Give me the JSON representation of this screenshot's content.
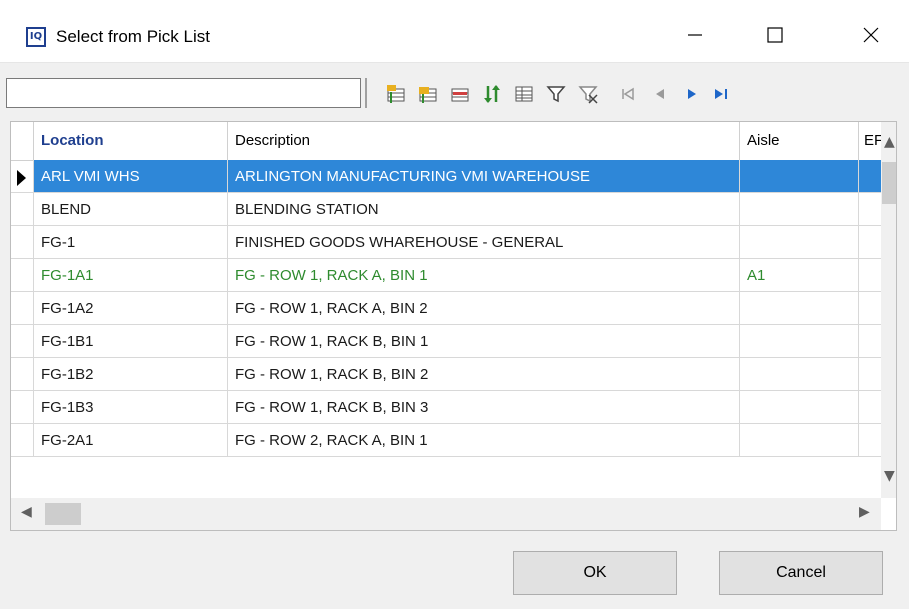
{
  "window": {
    "title": "Select from Pick List",
    "icon_text": "IQ"
  },
  "search": {
    "value": "",
    "placeholder": ""
  },
  "toolbar": {
    "icons": [
      "insert-before-icon",
      "insert-after-icon",
      "delete-record-icon",
      "sort-icon",
      "grid-layout-icon",
      "filter-icon",
      "clear-filter-icon",
      "first-record-icon",
      "prior-record-icon",
      "next-record-icon",
      "last-record-icon"
    ]
  },
  "grid": {
    "columns": [
      "Location",
      "Description",
      "Aisle",
      "EF"
    ],
    "rows": [
      {
        "location": "ARL VMI WHS",
        "description": "ARLINGTON MANUFACTURING VMI WAREHOUSE",
        "aisle": "",
        "ef": "",
        "state": "selected"
      },
      {
        "location": "BLEND",
        "description": "BLENDING STATION",
        "aisle": "",
        "ef": "",
        "state": "normal"
      },
      {
        "location": "FG-1",
        "description": "FINISHED GOODS WHAREHOUSE - GENERAL",
        "aisle": "",
        "ef": "",
        "state": "normal"
      },
      {
        "location": "FG-1A1",
        "description": "FG - ROW 1, RACK A, BIN 1",
        "aisle": "A1",
        "ef": "",
        "state": "green"
      },
      {
        "location": "FG-1A2",
        "description": "FG - ROW 1, RACK A, BIN 2",
        "aisle": "",
        "ef": "",
        "state": "normal"
      },
      {
        "location": "FG-1B1",
        "description": "FG - ROW 1, RACK B, BIN 1",
        "aisle": "",
        "ef": "",
        "state": "normal"
      },
      {
        "location": "FG-1B2",
        "description": "FG - ROW 1, RACK B, BIN 2",
        "aisle": "",
        "ef": "",
        "state": "normal"
      },
      {
        "location": "FG-1B3",
        "description": "FG - ROW 1, RACK B, BIN 3",
        "aisle": "",
        "ef": "",
        "state": "normal"
      },
      {
        "location": "FG-2A1",
        "description": "FG - ROW 2, RACK A, BIN 1",
        "aisle": "",
        "ef": "",
        "state": "normal"
      }
    ]
  },
  "buttons": {
    "ok": "OK",
    "cancel": "Cancel"
  },
  "colors": {
    "selection": "#2e87d8",
    "highlight_text": "#2e8b2e",
    "header_accent": "#1f3f8f",
    "nav_blue": "#1e66c8"
  }
}
